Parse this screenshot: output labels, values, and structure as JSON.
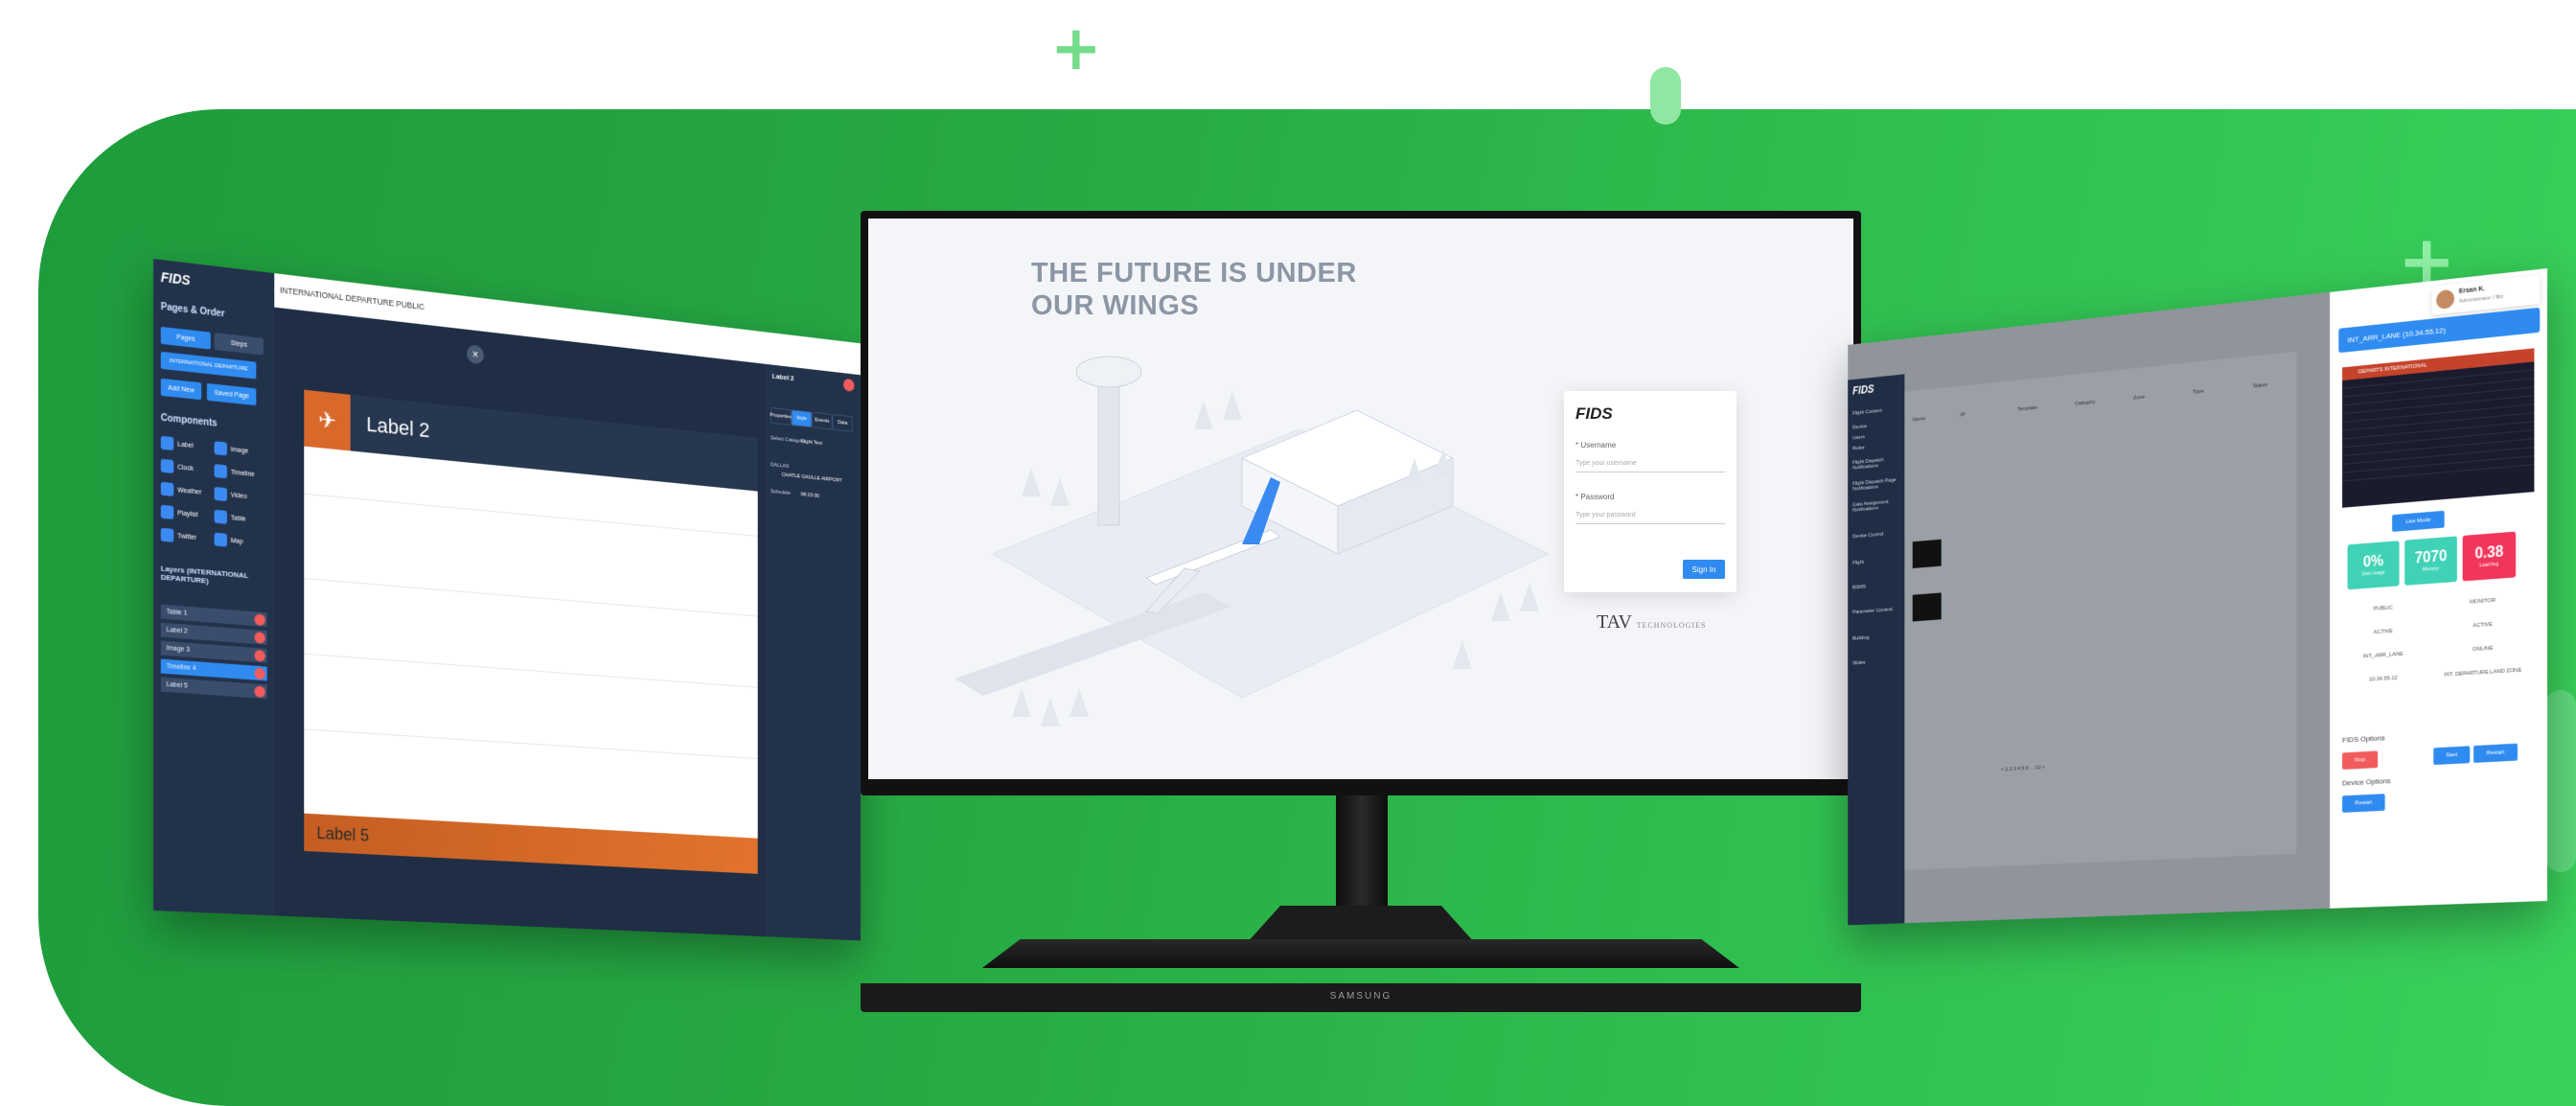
{
  "colors": {
    "accent": "#2f8bf0",
    "hero_green": "#2db34a",
    "orange": "#d8692a",
    "danger": "#f25c5c"
  },
  "left_panel": {
    "logo": "FIDS",
    "title": "INTERNATIONAL DEPARTURE PUBLIC",
    "section_pages": "Pages & Order",
    "tab_pages": "Pages",
    "tab_steps": "Steps",
    "page_item": "INTERNATIONAL DEPARTURE",
    "btn_add_new": "Add New",
    "btn_saved": "Saved Page",
    "section_components": "Components",
    "components": [
      "Label",
      "Image",
      "Clock",
      "Timeline",
      "Weather",
      "Video",
      "Playlist",
      "Table",
      "Twitter",
      "Map"
    ],
    "section_layers": "Layers (INTERNATIONAL DEPARTURE)",
    "layers": [
      "Table 1",
      "Label 2",
      "Image 3",
      "Timeline 4",
      "Label 5"
    ],
    "canvas_label_top": "Label 2",
    "canvas_label_bottom": "Label 5",
    "right_title": "Label 2",
    "right_tabs": [
      "Properties",
      "Style",
      "Events",
      "Data"
    ],
    "right_fields": [
      "Select Category",
      "Flight Text",
      "DALLAS",
      "CHATLE GAULLE AIRPORT",
      "Schedule",
      "08:15:00"
    ]
  },
  "monitor": {
    "brand": "SAMSUNG",
    "headline_line1": "THE FUTURE IS UNDER",
    "headline_line2": "OUR WINGS",
    "login": {
      "logo": "FIDS",
      "username_label": "* Username",
      "username_placeholder": "Type your username",
      "password_label": "* Password",
      "password_placeholder": "Type your password",
      "sign_in": "Sign In"
    },
    "partner": "TAV",
    "partner_sub": "TECHNOLOGIES"
  },
  "right_panel": {
    "logo": "FIDS",
    "user_name": "Ersan K.",
    "user_role": "Administrator / Biz",
    "nav": [
      "Flight Content",
      "Device",
      "Users",
      "Roles",
      "Flight Dispatch Notifications",
      "Flight Dispatch Page Notifications",
      "Gate Assignment Notifications",
      "Device Control",
      "Flight",
      "BSMS",
      "Parameter Content",
      "Building",
      "Slides"
    ],
    "columns": [
      "Name",
      "IP",
      "Template",
      "Category",
      "Zone",
      "Type",
      "Status"
    ],
    "detail_header": "INT_ARR_LANE (10.34.55.12)",
    "board_title": "DEPARTS INTERNATIONAL",
    "stats": [
      {
        "value": "0%",
        "label": "Disk Usage"
      },
      {
        "value": "7070",
        "label": "Memory"
      },
      {
        "value": "0.38",
        "label": "Load Avg"
      }
    ],
    "device_category": "PUBLIC",
    "device_type": "MONITOR",
    "device_status": "ACTIVE",
    "device_mode": "ACTIVE",
    "template": "INT_ARR_LANE",
    "network_status": "ONLINE",
    "ip": "10.34.55.12",
    "terminal_zone": "INT. DEPARTURE LAND ZONE",
    "fids_options": "FIDS Options",
    "device_options": "Device Options",
    "btn_stop": "Stop",
    "btn_start": "Start",
    "btn_restart": "Restart",
    "btn_restart_device": "Restart",
    "btn_live": "Live Mode",
    "pagination": "< 1 2 3 4 5 6 ... 10 >"
  }
}
